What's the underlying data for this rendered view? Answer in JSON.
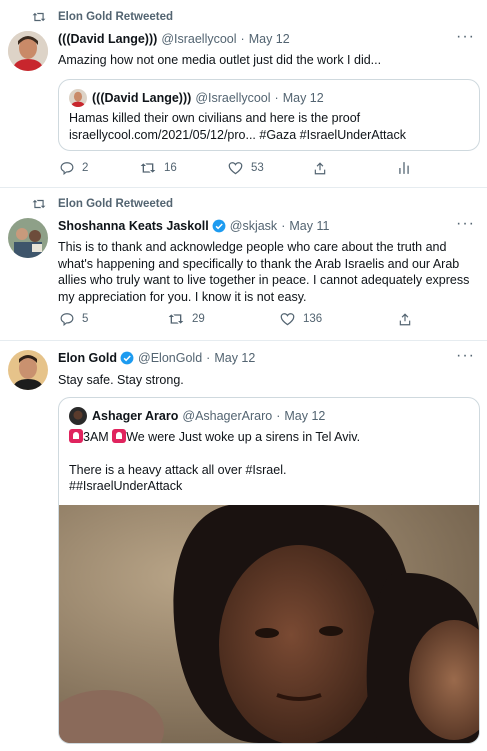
{
  "tweets": [
    {
      "retweeted_by": "Elon Gold Retweeted",
      "name": "(((David Lange)))",
      "handle": "@Israellycool",
      "date": "May 12",
      "text": "Amazing how not one media outlet just did the work I did...",
      "quote": {
        "name": "(((David Lange)))",
        "handle": "@Israellycool",
        "date": "May 12",
        "line1": "Hamas killed their own civilians and here is the proof",
        "line2": "israellycool.com/2021/05/12/pro... #Gaza #IsraelUnderAttack"
      },
      "replies": "2",
      "retweets": "16",
      "likes": "53"
    },
    {
      "retweeted_by": "Elon Gold Retweeted",
      "name": "Shoshanna Keats Jaskoll",
      "handle": "@skjask",
      "date": "May 11",
      "text": "This is to thank and acknowledge people who care about the truth and what's happening and specifically to thank the Arab Israelis and our Arab allies who truly want to live together in peace. I cannot adequately express my appreciation for you. I know it is not easy.",
      "replies": "5",
      "retweets": "29",
      "likes": "136"
    },
    {
      "name": "Elon Gold",
      "handle": "@ElonGold",
      "date": "May 12",
      "text": "Stay safe. Stay strong.",
      "quote": {
        "name": "Ashager Araro",
        "handle": "@AshagerAraro",
        "date": "May 12",
        "line1_a": "3AM",
        "line1_b": "We were Just woke up a sirens in Tel Aviv.",
        "line2": "There is a heavy attack all over #Israel.",
        "line3": "##IsraelUnderAttack"
      }
    }
  ],
  "separator": "·",
  "more": "···",
  "colors": {
    "verified": "#1d9bf0",
    "muted": "#536471",
    "border": "#cfd9de"
  }
}
